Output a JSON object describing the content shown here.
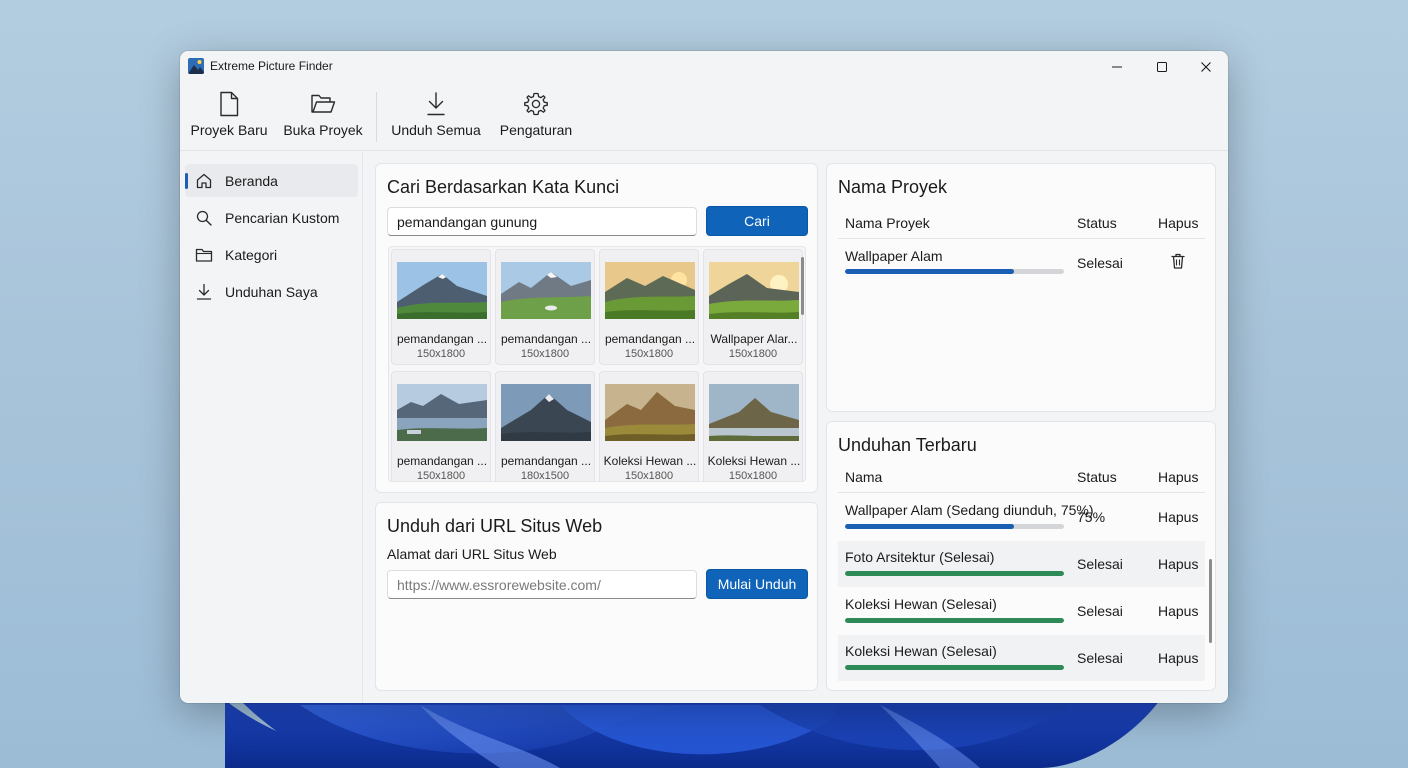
{
  "window": {
    "title": "Extreme Picture Finder"
  },
  "toolbar": {
    "new_project": "Proyek Baru",
    "open_project": "Buka Proyek",
    "download_all": "Unduh Semua",
    "settings": "Pengaturan"
  },
  "sidebar": {
    "items": [
      {
        "label": "Beranda",
        "icon": "home-icon",
        "active": true
      },
      {
        "label": "Pencarian Kustom",
        "icon": "search-icon",
        "active": false
      },
      {
        "label": "Kategori",
        "icon": "folder-icon",
        "active": false
      },
      {
        "label": "Unduhan Saya",
        "icon": "download-icon",
        "active": false
      }
    ]
  },
  "keyword_search": {
    "title": "Cari Berdasarkan Kata Kunci",
    "query": "pemandangan gunung",
    "button": "Cari",
    "results": [
      {
        "name": "pemandangan ...",
        "size": "150x1800"
      },
      {
        "name": "pemandangan ...",
        "size": "150x1800"
      },
      {
        "name": "pemandangan ...",
        "size": "150x1800"
      },
      {
        "name": "Wallpaper Alar...",
        "size": "150x1800"
      },
      {
        "name": "pemandangan ...",
        "size": "150x1800"
      },
      {
        "name": "pemandangan ...",
        "size": "180x1500"
      },
      {
        "name": "Koleksi Hewan ...",
        "size": "150x1800"
      },
      {
        "name": "Koleksi Hewan ...",
        "size": "150x1800"
      }
    ]
  },
  "url_download": {
    "title": "Unduh dari URL Situs Web",
    "label": "Alamat dari URL Situs Web",
    "placeholder": "https://www.essrorewebsite.com/",
    "button": "Mulai Unduh"
  },
  "projects": {
    "title": "Nama Proyek",
    "headers": {
      "name": "Nama Proyek",
      "status": "Status",
      "delete": "Hapus"
    },
    "rows": [
      {
        "name": "Wallpaper Alam",
        "status": "Selesai",
        "progress": 0.77
      }
    ]
  },
  "recent_downloads": {
    "title": "Unduhan Terbaru",
    "headers": {
      "name": "Nama",
      "status": "Status",
      "delete": "Hapus"
    },
    "rows": [
      {
        "name": "Wallpaper Alam (Sedang diunduh, 75%)",
        "status": "75%",
        "delete": "Hapus",
        "progress": 0.77,
        "state": "active"
      },
      {
        "name": "Foto Arsitektur (Selesai)",
        "status": "Selesai",
        "delete": "Hapus",
        "progress": 1.0,
        "state": "done"
      },
      {
        "name": "Koleksi Hewan (Selesai)",
        "status": "Selesai",
        "delete": "Hapus",
        "progress": 1.0,
        "state": "done"
      },
      {
        "name": "Koleksi Hewan (Selesai)",
        "status": "Selesai",
        "delete": "Hapus",
        "progress": 1.0,
        "state": "done"
      }
    ]
  },
  "colors": {
    "accent": "#0f63b8",
    "progress_active": "#1a5fb4",
    "progress_done": "#2e8b57"
  }
}
